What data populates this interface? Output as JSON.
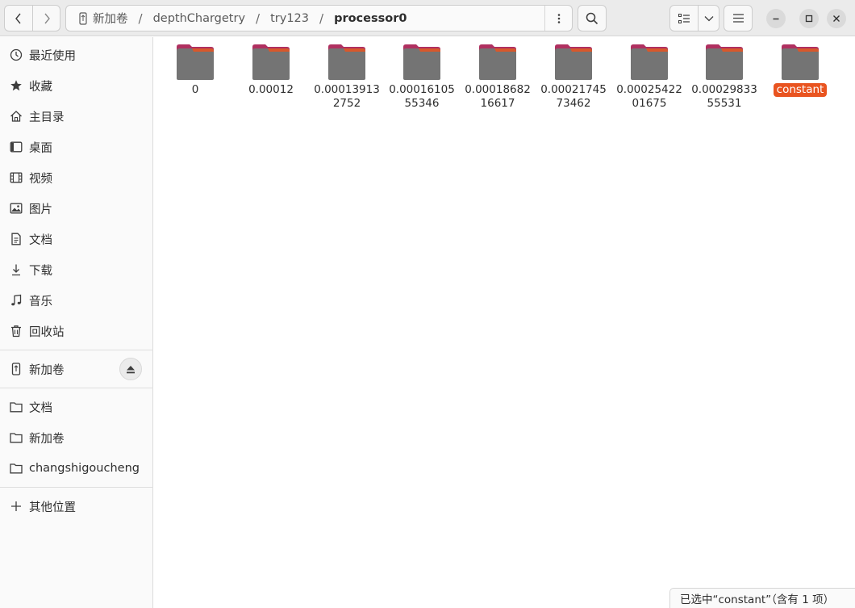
{
  "toolbar": {
    "path": [
      "新加卷",
      "depthChargetry",
      "try123",
      "processor0"
    ],
    "separator": "/"
  },
  "sidebar": {
    "places": [
      {
        "label": "最近使用",
        "icon": "clock-icon"
      },
      {
        "label": "收藏",
        "icon": "star-icon"
      },
      {
        "label": "主目录",
        "icon": "home-icon"
      },
      {
        "label": "桌面",
        "icon": "desktop-icon"
      },
      {
        "label": "视频",
        "icon": "video-icon"
      },
      {
        "label": "图片",
        "icon": "picture-icon"
      },
      {
        "label": "文档",
        "icon": "document-icon"
      },
      {
        "label": "下载",
        "icon": "download-icon"
      },
      {
        "label": "音乐",
        "icon": "music-icon"
      },
      {
        "label": "回收站",
        "icon": "trash-icon"
      }
    ],
    "device": {
      "label": "新加卷",
      "icon": "usb-drive-icon"
    },
    "bookmarks": [
      {
        "label": "文档",
        "icon": "folder-icon"
      },
      {
        "label": "新加卷",
        "icon": "folder-icon"
      },
      {
        "label": "changshigoucheng",
        "icon": "folder-icon"
      }
    ],
    "other": {
      "label": "其他位置",
      "icon": "plus-icon"
    }
  },
  "files": [
    {
      "name": "0"
    },
    {
      "name": "0.00012"
    },
    {
      "name": "0.000139132752"
    },
    {
      "name": "0.0001610555346"
    },
    {
      "name": "0.0001868216617"
    },
    {
      "name": "0.0002174573462"
    },
    {
      "name": "0.0002542201675"
    },
    {
      "name": "0.0002983355531"
    },
    {
      "name": "constant",
      "selected": true
    }
  ],
  "status": {
    "text": "已选中“constant”（含有 1 项）"
  },
  "colors": {
    "accent": "#e95420",
    "folder_body": "#747474",
    "folder_tab": "#b03060"
  }
}
